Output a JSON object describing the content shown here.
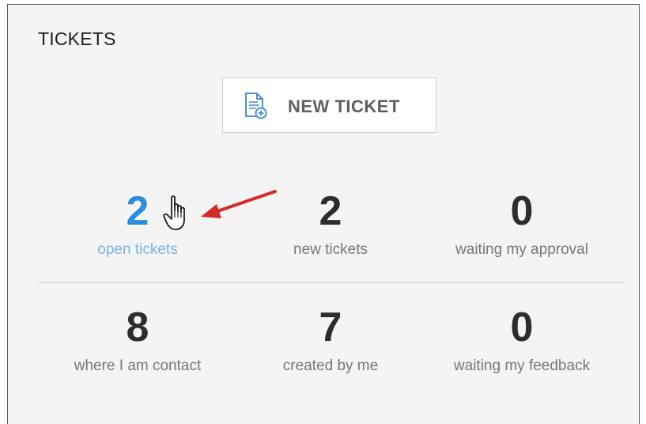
{
  "panel": {
    "title": "TICKETS"
  },
  "new_ticket_button": {
    "label": "NEW TICKET",
    "icon": "document-add-icon"
  },
  "stats": {
    "open": {
      "value": "2",
      "label": "open tickets"
    },
    "new": {
      "value": "2",
      "label": "new tickets"
    },
    "approval": {
      "value": "0",
      "label": "waiting my approval"
    },
    "contact": {
      "value": "8",
      "label": "where I am contact"
    },
    "created": {
      "value": "7",
      "label": "created by me"
    },
    "feedback": {
      "value": "0",
      "label": "waiting my feedback"
    }
  },
  "colors": {
    "accent": "#2a8ee0",
    "accent_label": "#79b4e6",
    "annotation_arrow": "#d32a2a",
    "panel_bg": "#f4f4f4"
  },
  "annotations": {
    "cursor": "hand-pointer-icon",
    "arrow": "red-arrow-icon"
  }
}
